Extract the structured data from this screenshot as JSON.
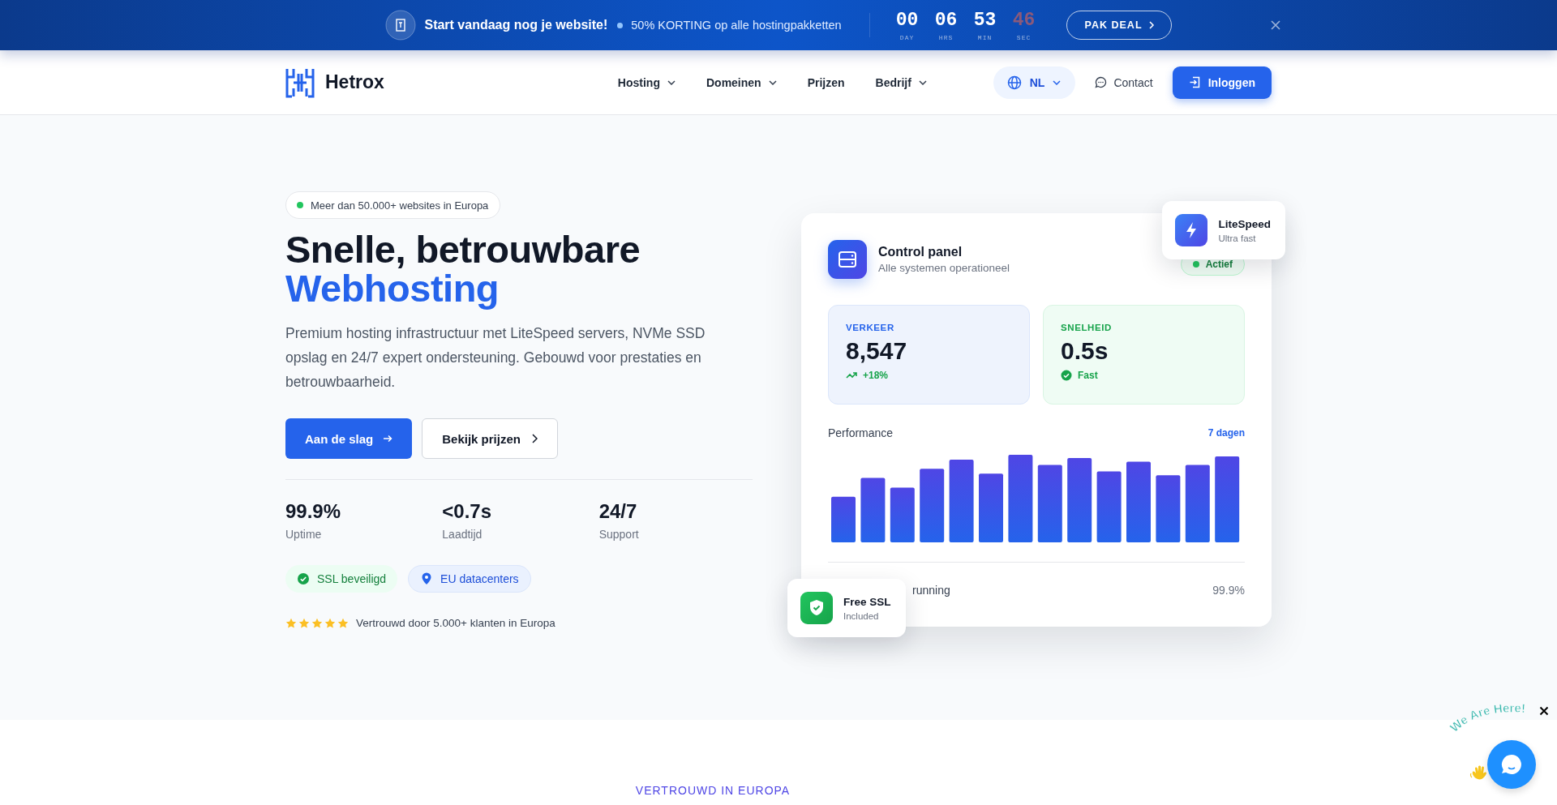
{
  "promo_bar": {
    "headline": "Start vandaag nog je website!",
    "offer": "50% KORTING op alle hostingpakketten",
    "countdown": [
      {
        "value": "00",
        "unit": "DAY",
        "dimmed": false
      },
      {
        "value": "06",
        "unit": "HRS",
        "dimmed": false
      },
      {
        "value": "53",
        "unit": "MIN",
        "dimmed": false
      },
      {
        "value": "46",
        "unit": "SEC",
        "dimmed": true
      }
    ],
    "cta": "PAK DEAL"
  },
  "nav": {
    "brand": "Hetrox",
    "links": [
      {
        "label": "Hosting",
        "dropdown": true
      },
      {
        "label": "Domeinen",
        "dropdown": true
      },
      {
        "label": "Prijzen",
        "dropdown": false
      },
      {
        "label": "Bedrijf",
        "dropdown": true
      }
    ],
    "language": "NL",
    "contact": "Contact",
    "login": "Inloggen"
  },
  "hero": {
    "badge": "Meer dan 50.000+ websites in Europa",
    "title_line1": "Snelle, betrouwbare",
    "title_line2": "Webhosting",
    "intro": "Premium hosting infrastructuur met LiteSpeed servers, NVMe SSD opslag en 24/7 expert ondersteuning. Gebouwd voor prestaties en betrouwbaarheid.",
    "primary_button": "Aan de slag",
    "secondary_button": "Bekijk prijzen",
    "stats": [
      {
        "value": "99.9%",
        "label": "Uptime"
      },
      {
        "value": "<0.7s",
        "label": "Laadtijd"
      },
      {
        "value": "24/7",
        "label": "Support"
      }
    ],
    "chips": [
      {
        "label": "SSL beveiligd",
        "kind": "ssl"
      },
      {
        "label": "EU datacenters",
        "kind": "location"
      }
    ],
    "rating": {
      "stars": 5,
      "text": "Vertrouwd door 5.000+ klanten in Europa"
    }
  },
  "dashboard": {
    "title": "Control panel",
    "subtitle": "Alle systemen operationeel",
    "status": "Actief",
    "metrics": [
      {
        "label": "VERKEER",
        "value": "8,547",
        "note": "+18%",
        "kind": "traffic"
      },
      {
        "label": "SNELHEID",
        "value": "0.5s",
        "note": "Fast",
        "kind": "speed"
      }
    ],
    "chart_title": "Performance",
    "chart_range": "7 dagen",
    "footer_label": "running",
    "footer_value": "99.9%"
  },
  "floating_cards": [
    {
      "title": "LiteSpeed",
      "subtitle": "Ultra fast",
      "kind": "speed"
    },
    {
      "title": "Free SSL",
      "subtitle": "Included",
      "kind": "ssl"
    }
  ],
  "section_label": "VERTROUWD IN EUROPA",
  "chat_widget": {
    "caption": "We Are Here!"
  }
}
